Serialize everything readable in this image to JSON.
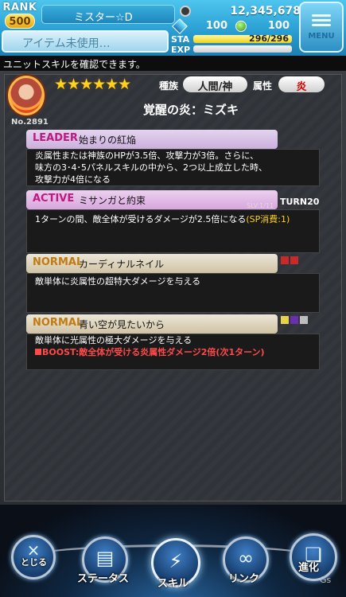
{
  "header": {
    "rank_label": "RANK",
    "rank_value": "500",
    "player_name": "ミスター☆D",
    "item_label": "アイテム未使用…",
    "money": "12,345,678",
    "stone1": "100",
    "stone2": "100",
    "sta_label": "STA",
    "sta_value": "296/296",
    "sta_fraction": 1.0,
    "exp_label": "EXP",
    "exp_fraction": 1.0,
    "menu_label": "MENU"
  },
  "info_bar": {
    "text": "ユニットスキルを確認できます。"
  },
  "unit": {
    "number": "No.2891",
    "stars": "★★★★★★",
    "race_label": "種族",
    "race_value": "人間/神",
    "attr_label": "属性",
    "attr_value": "炎",
    "name": "覚醒の炎：ミズキ"
  },
  "skills": {
    "leader": {
      "type": "LEADER",
      "name": "始まりの紅焔",
      "lines": [
        "炎属性または神族のHPが3.5倍、攻撃力が3倍。さらに、",
        "味方の3･4･5パネルスキルの中から、2つ以上成立した時、",
        "攻撃力が4倍になる"
      ]
    },
    "active": {
      "type": "ACTIVE",
      "name": "ミサンガと約束",
      "slv": "SLV:1/11",
      "turn": "TURN20",
      "text": "1ターンの間、敵全体が受けるダメージが2.5倍になる",
      "sp": "(SP消費:1)"
    },
    "normal1": {
      "type": "NORMAL",
      "name": "カーディナルネイル",
      "text": "敵単体に炎属性の超特大ダメージを与える"
    },
    "normal2": {
      "type": "NORMAL",
      "name": "青い空が見たいから",
      "text": "敵単体に光属性の極大ダメージを与える",
      "boost": "BOOST:敵全体が受ける炎属性ダメージ2倍(次1ターン)"
    }
  },
  "nav": {
    "close_label": "とじる",
    "close_mark": "×",
    "status_label": "ステータス",
    "skill_label": "スキル",
    "link_label": "リンク",
    "evolve_label": "進化"
  },
  "watermark": "Gs",
  "colors": {
    "header_blue": "#2a9fd3",
    "leader_head": "#c9b0dc",
    "active_head": "#d7a6dd",
    "normal_head": "#cfc3a4",
    "sp_yellow": "#ffd21e",
    "boost_red": "#ff4a4a",
    "type_leader": "#c01880",
    "type_active": "#c01880",
    "type_normal": "#c07a10"
  }
}
